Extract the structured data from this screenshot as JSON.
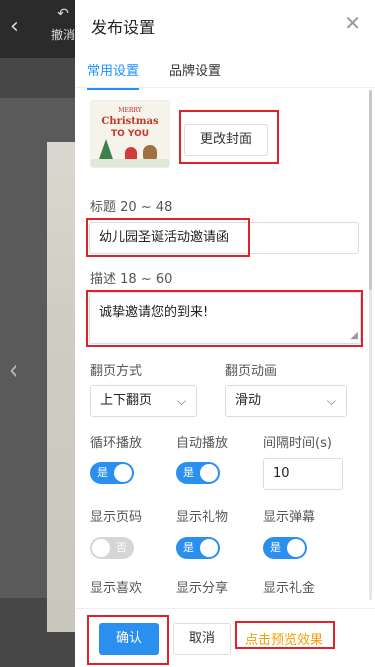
{
  "background": {
    "back_glyph": "‹",
    "undo_arrow": "↶",
    "undo_label": "撤消",
    "prev_glyph": "‹"
  },
  "panel": {
    "title": "发布设置",
    "close_glyph": "✕"
  },
  "tabs": [
    {
      "label": "常用设置",
      "active": true
    },
    {
      "label": "品牌设置",
      "active": false
    }
  ],
  "cover": {
    "thumb_line1": "MERRY",
    "thumb_line2": "Christmas",
    "thumb_line3": "TO YOU",
    "change_label": "更改封面"
  },
  "title_field": {
    "label": "标题 20 ~ 48",
    "value": "幼儿园圣诞活动邀请函"
  },
  "desc_field": {
    "label": "描述 18 ~ 60",
    "value": "诚挚邀请您的到来!"
  },
  "page_turn": {
    "label": "翻页方式",
    "value": "上下翻页"
  },
  "page_anim": {
    "label": "翻页动画",
    "value": "滑动"
  },
  "toggles_row1": {
    "loop_label": "循环播放",
    "loop_value": "是",
    "auto_label": "自动播放",
    "auto_value": "是",
    "interval_label": "间隔时间(s)",
    "interval_value": "10"
  },
  "toggles_row2": {
    "page_num_label": "显示页码",
    "page_num_value": "否",
    "gift_label": "显示礼物",
    "gift_value": "是",
    "danmu_label": "显示弹幕",
    "danmu_value": "是"
  },
  "row3_labels": {
    "like": "显示喜欢",
    "share": "显示分享",
    "gift_money": "显示礼金"
  },
  "footer": {
    "confirm_label": "确认",
    "cancel_label": "取消",
    "preview_label": "点击预览效果"
  },
  "colors": {
    "accent": "#2b8ff0",
    "highlight": "#e0202a",
    "preview": "#f5a000"
  }
}
